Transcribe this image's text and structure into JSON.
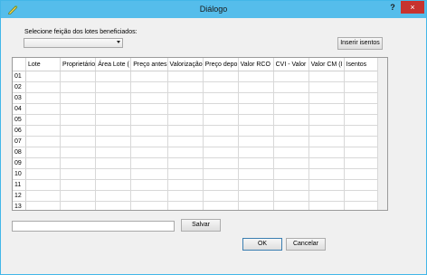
{
  "window": {
    "title": "Diálogo",
    "help": "?",
    "close": "×"
  },
  "form": {
    "select_label": "Selecione feição dos lotes beneficiados:",
    "select_value": "",
    "insert_button": "Inserir isentos"
  },
  "table": {
    "columns": [
      "Lote",
      "Proprietário",
      "Área Lote (",
      "Preço antes",
      "Valorização",
      "Preço depo",
      "Valor RCO",
      "CVI - Valor",
      "Valor CM (I",
      "Isentos"
    ],
    "rows": [
      "01",
      "02",
      "03",
      "04",
      "05",
      "06",
      "07",
      "08",
      "09",
      "10",
      "11",
      "12",
      "13"
    ]
  },
  "footer": {
    "save_path_value": "",
    "save_button": "Salvar",
    "ok_button": "OK",
    "cancel_button": "Cancelar"
  },
  "colors": {
    "titlebar": "#55bdeb",
    "close": "#c7332f"
  }
}
